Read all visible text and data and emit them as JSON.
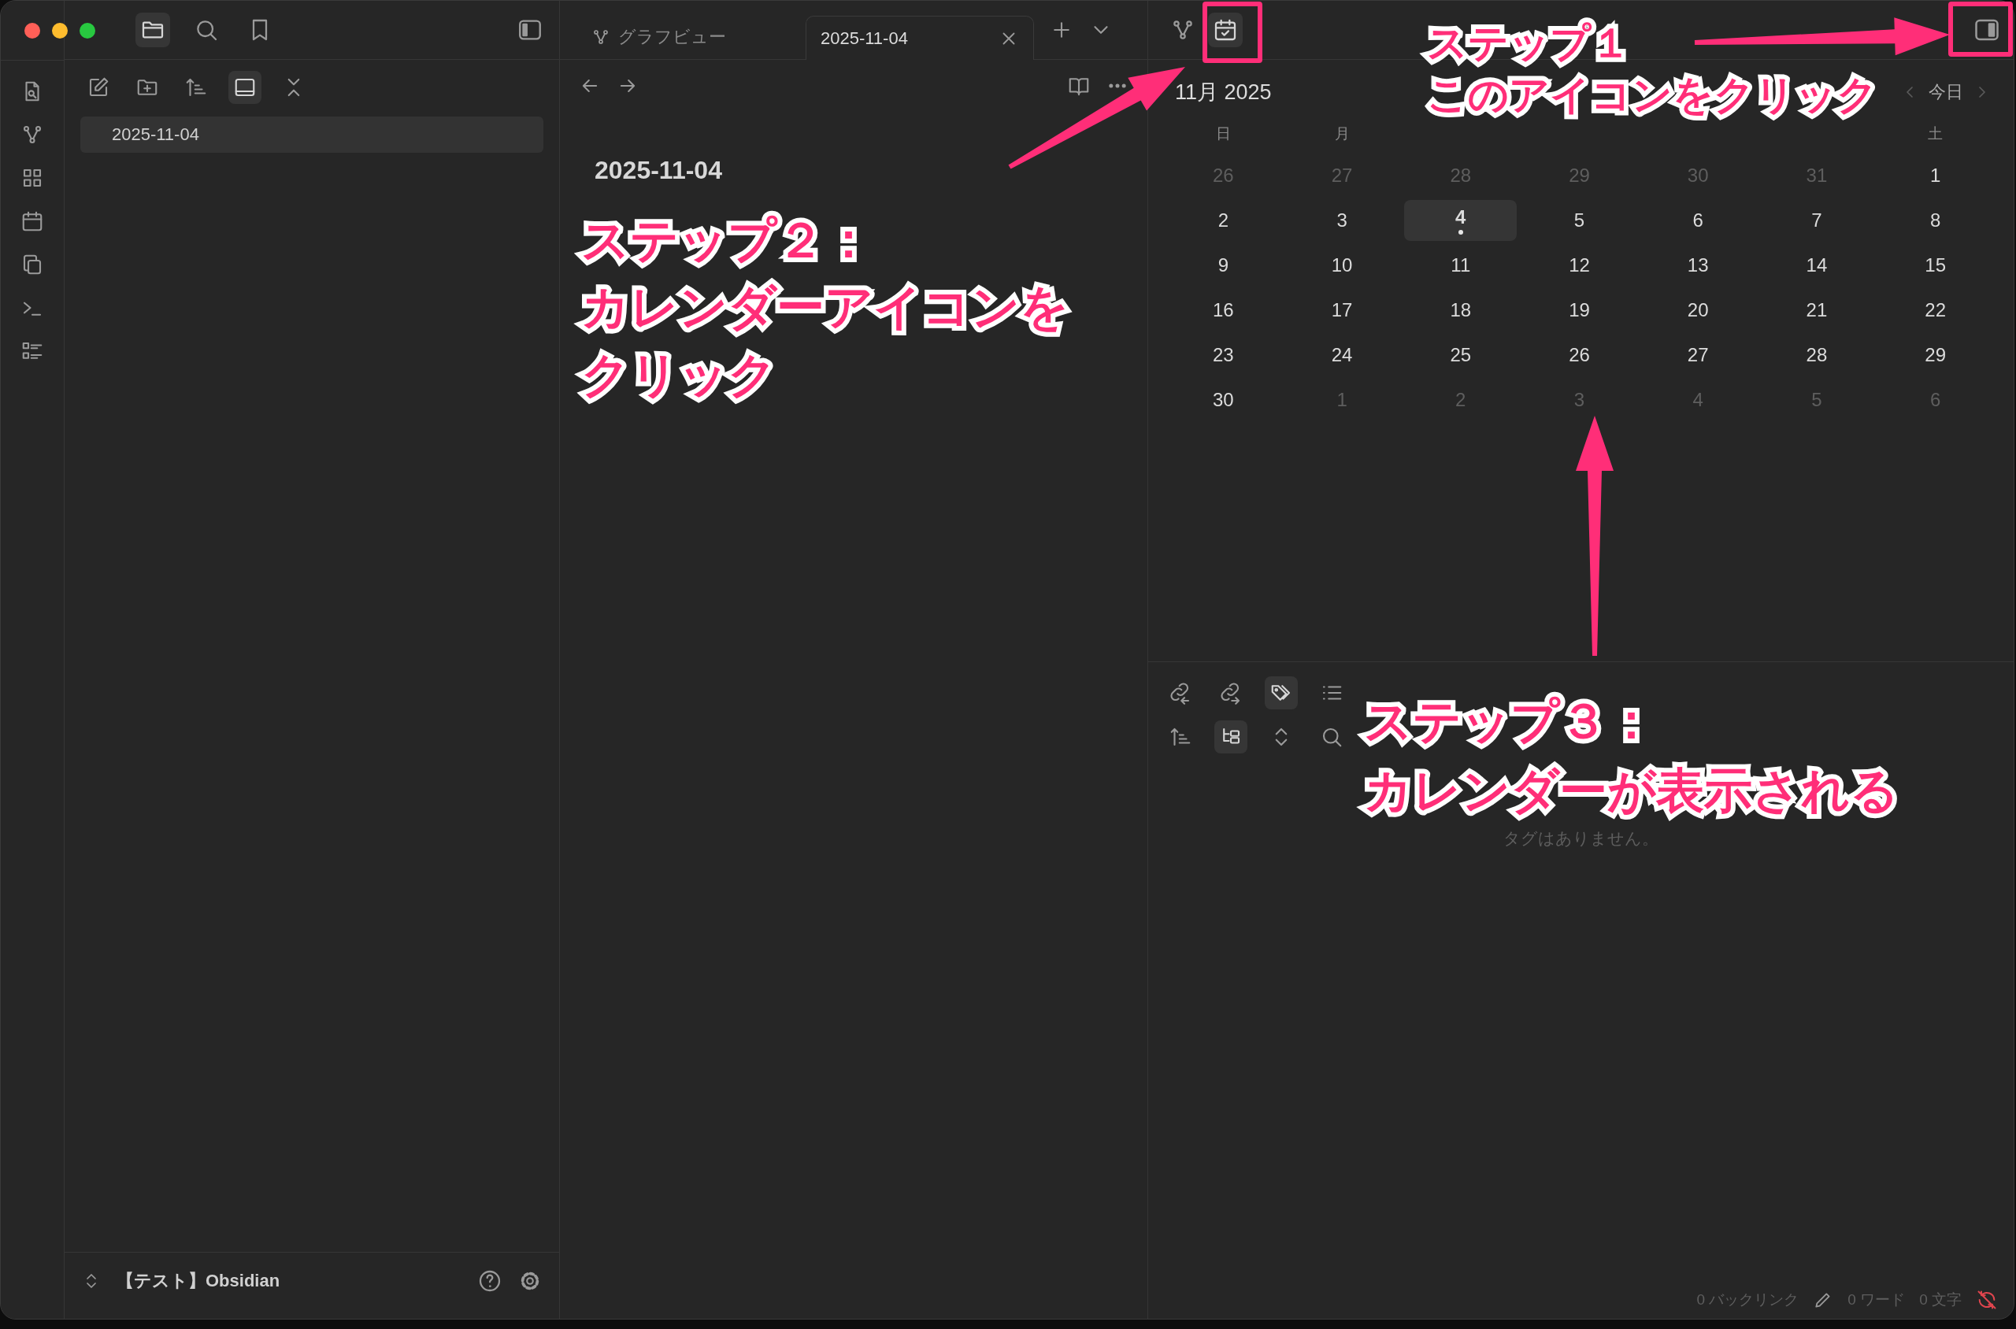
{
  "window": {
    "traffic_lights": [
      {
        "color": "#ff5f57"
      },
      {
        "color": "#febc2e"
      },
      {
        "color": "#28c840"
      }
    ]
  },
  "left_title_buttons": [
    {
      "kind": "folder",
      "selected": true
    },
    {
      "kind": "search",
      "selected": false
    },
    {
      "kind": "bookmark",
      "selected": false
    }
  ],
  "ribbon": [
    {
      "kind": "file-search"
    },
    {
      "kind": "graph"
    },
    {
      "kind": "grid"
    },
    {
      "kind": "calendar"
    },
    {
      "kind": "copy"
    },
    {
      "kind": "terminal"
    },
    {
      "kind": "list-checks"
    }
  ],
  "file_explorer": {
    "toolbar": [
      {
        "kind": "edit",
        "selected": false
      },
      {
        "kind": "folder-plus",
        "selected": false
      },
      {
        "kind": "sort",
        "selected": false
      },
      {
        "kind": "layout",
        "selected": true
      },
      {
        "kind": "collapse",
        "selected": false
      }
    ],
    "files": [
      {
        "name": "2025-11-04",
        "selected": true
      }
    ],
    "vault_name": "【テスト】Obsidian"
  },
  "tabs": [
    {
      "label": "グラフビュー",
      "kind": "graph",
      "selected": false
    },
    {
      "label": "2025-11-04",
      "kind": "note",
      "selected": true
    }
  ],
  "editor": {
    "title": "2025-11-04"
  },
  "right_panel": {
    "tabs": [
      {
        "kind": "graph",
        "selected": false
      },
      {
        "kind": "calendar-check",
        "selected": true
      }
    ],
    "calendar": {
      "month_title": "11月 2025",
      "today_label": "今日",
      "weekday_labels": {
        "sun": "日",
        "mon": "月",
        "sat": "土"
      },
      "weeks": [
        [
          {
            "day": "26",
            "outside": true
          },
          {
            "day": "27",
            "outside": true
          },
          {
            "day": "28",
            "outside": true
          },
          {
            "day": "29",
            "outside": true
          },
          {
            "day": "30",
            "outside": true
          },
          {
            "day": "31",
            "outside": true
          },
          {
            "day": "1",
            "outside": false
          }
        ],
        [
          {
            "day": "2",
            "outside": false
          },
          {
            "day": "3",
            "outside": false
          },
          {
            "day": "4",
            "outside": false,
            "today": true,
            "has_note": true
          },
          {
            "day": "5",
            "outside": false
          },
          {
            "day": "6",
            "outside": false
          },
          {
            "day": "7",
            "outside": false
          },
          {
            "day": "8",
            "outside": false
          }
        ],
        [
          {
            "day": "9",
            "outside": false
          },
          {
            "day": "10",
            "outside": false
          },
          {
            "day": "11",
            "outside": false
          },
          {
            "day": "12",
            "outside": false
          },
          {
            "day": "13",
            "outside": false
          },
          {
            "day": "14",
            "outside": false
          },
          {
            "day": "15",
            "outside": false
          }
        ],
        [
          {
            "day": "16",
            "outside": false
          },
          {
            "day": "17",
            "outside": false
          },
          {
            "day": "18",
            "outside": false
          },
          {
            "day": "19",
            "outside": false
          },
          {
            "day": "20",
            "outside": false
          },
          {
            "day": "21",
            "outside": false
          },
          {
            "day": "22",
            "outside": false
          }
        ],
        [
          {
            "day": "23",
            "outside": false
          },
          {
            "day": "24",
            "outside": false
          },
          {
            "day": "25",
            "outside": false
          },
          {
            "day": "26",
            "outside": false
          },
          {
            "day": "27",
            "outside": false
          },
          {
            "day": "28",
            "outside": false
          },
          {
            "day": "29",
            "outside": false
          }
        ],
        [
          {
            "day": "30",
            "outside": false
          },
          {
            "day": "1",
            "outside": true
          },
          {
            "day": "2",
            "outside": true
          },
          {
            "day": "3",
            "outside": true
          },
          {
            "day": "4",
            "outside": true
          },
          {
            "day": "5",
            "outside": true
          },
          {
            "day": "6",
            "outside": true
          }
        ]
      ]
    },
    "lower_tabs": [
      {
        "kind": "link-in",
        "selected": false
      },
      {
        "kind": "link-out",
        "selected": false
      },
      {
        "kind": "tags",
        "selected": true
      },
      {
        "kind": "list",
        "selected": false
      }
    ],
    "lower_toolbar": [
      {
        "kind": "sort",
        "selected": false
      },
      {
        "kind": "tree",
        "selected": true
      },
      {
        "kind": "chevrons-up-down",
        "selected": false
      },
      {
        "kind": "search",
        "selected": false
      }
    ],
    "empty_message": "タグはありません。"
  },
  "status_bar": {
    "backlinks": "0 バックリンク",
    "words": "0 ワード",
    "chars": "0 文字",
    "sync_off": true
  },
  "annotations": [
    {
      "lines": [
        "ステップ１",
        "このアイコンをクリック"
      ]
    },
    {
      "lines": [
        "ステップ２：",
        "カレンダーアイコンを",
        "クリック"
      ]
    },
    {
      "lines": [
        "ステップ３：",
        "カレンダーが表示される"
      ]
    }
  ]
}
